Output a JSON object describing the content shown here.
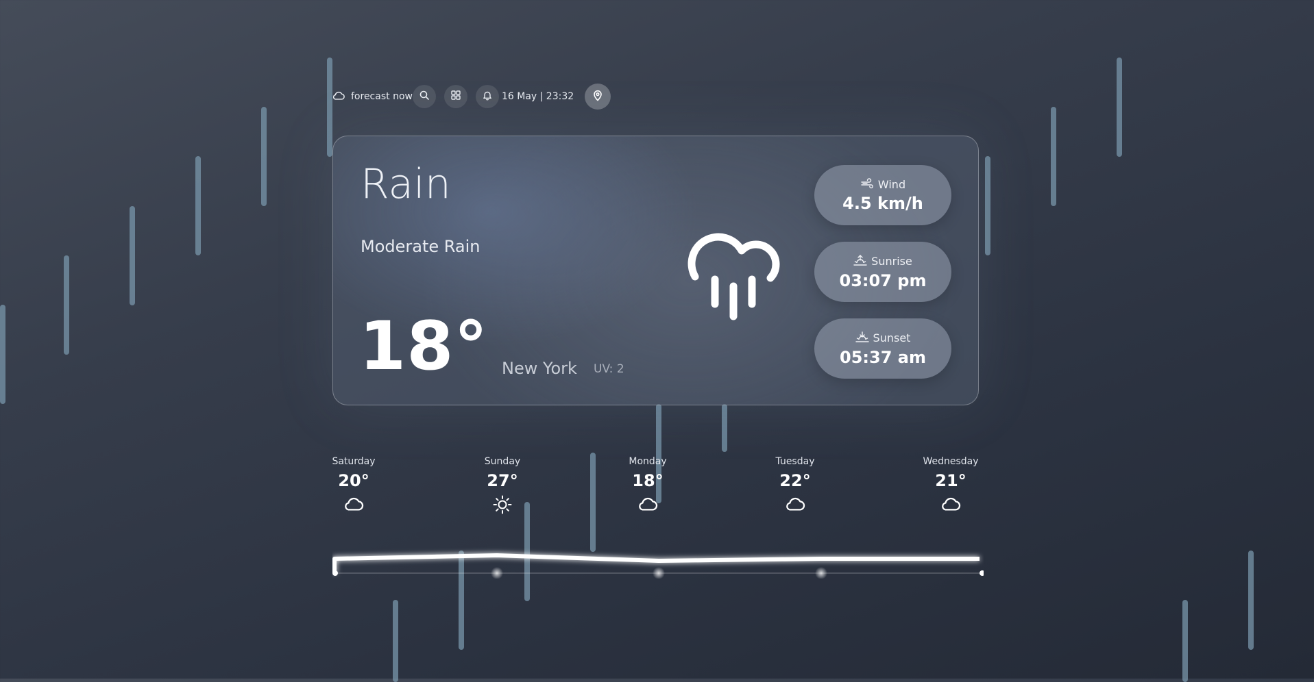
{
  "header": {
    "brand": "forecast now",
    "datetime": "16 May | 23:32"
  },
  "current": {
    "condition": "Rain",
    "description": "Moderate Rain",
    "temperature": "18°",
    "city": "New York",
    "uv": "UV: 2"
  },
  "stats": [
    {
      "label": "Wind",
      "value": "4.5 km/h",
      "icon": "wind-icon"
    },
    {
      "label": "Sunrise",
      "value": "03:07 pm",
      "icon": "sunrise-icon"
    },
    {
      "label": "Sunset",
      "value": "05:37 am",
      "icon": "sunset-icon"
    }
  ],
  "forecast": [
    {
      "day": "Saturday",
      "temp": "20°",
      "icon": "cloud-icon"
    },
    {
      "day": "Sunday",
      "temp": "27°",
      "icon": "sun-icon"
    },
    {
      "day": "Monday",
      "temp": "18°",
      "icon": "cloud-icon"
    },
    {
      "day": "Tuesday",
      "temp": "22°",
      "icon": "cloud-icon"
    },
    {
      "day": "Wednesday",
      "temp": "21°",
      "icon": "cloud-icon"
    }
  ],
  "colors": {
    "background": "#2f3644",
    "card": "#5c667a",
    "rain": "#7896aa",
    "text": "#ffffff"
  }
}
